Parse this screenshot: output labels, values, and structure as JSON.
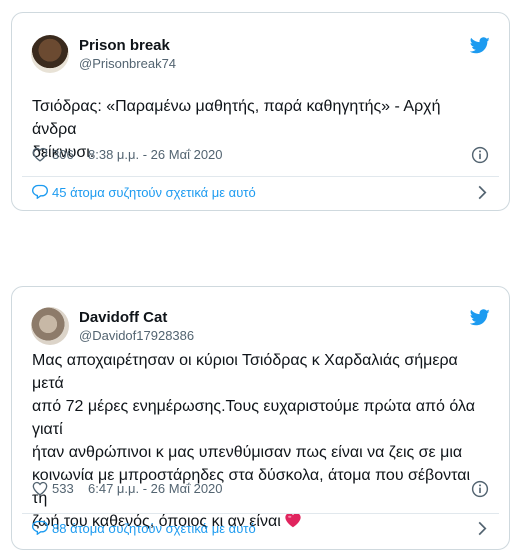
{
  "tweets": [
    {
      "name": "Prison break",
      "handle": "@Prisonbreak74",
      "text_lines": [
        "Τσιόδρας: «Παραμένω μαθητής, παρά καθηγητής» - Αρχή άνδρα",
        "δείκνυσι."
      ],
      "likes": "306",
      "time": "8:38 μ.μ. - 26 Μαΐ 2020",
      "discussion": "45 άτομα συζητούν σχετικά με αυτό"
    },
    {
      "name": "Davidoff Cat",
      "handle": "@Davidof17928386",
      "text_lines": [
        "Μας αποχαιρέτησαν οι κύριοι Τσιόδρας κ Χαρδαλιάς σήμερα μετά",
        "από 72 μέρες ενημέρωσης.Τους ευχαριστούμε πρώτα από όλα γιατί",
        "ήταν ανθρώπινοι κ μας υπενθύμισαν πως είναι να ζεις σε μια",
        "κοινωνία με μπροστάρηδες στα δύσκολα, άτομα που σέβονται τη",
        "ζωή του καθενός, όποιος κι αν είναι"
      ],
      "likes": "533",
      "time": "6:47 μ.μ. - 26 Μαΐ 2020",
      "discussion": "88 άτομα συζητούν σχετικά με αυτό"
    }
  ],
  "colors": {
    "twitter_blue": "#1d9bf0",
    "heart_emoji": "#e0245e"
  },
  "icons": [
    "twitter-bird-icon",
    "heart-icon",
    "info-icon",
    "comment-bubble-icon",
    "chevron-right-icon",
    "heart-emoji-icon"
  ]
}
